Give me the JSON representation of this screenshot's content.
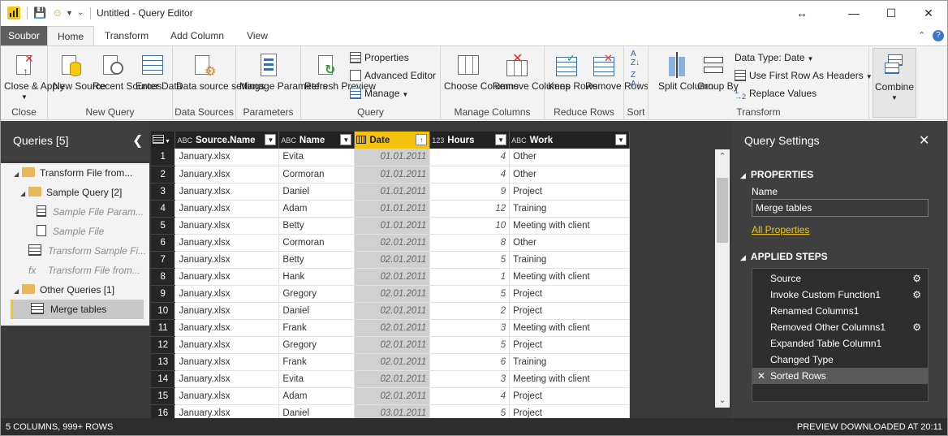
{
  "window": {
    "title": "Untitled - Query Editor",
    "minimize": "—",
    "maximize": "☐",
    "close": "✕",
    "resize": "↔"
  },
  "tabs": [
    {
      "label": "Soubor"
    },
    {
      "label": "Home"
    },
    {
      "label": "Transform"
    },
    {
      "label": "Add Column"
    },
    {
      "label": "View"
    }
  ],
  "ribbon": {
    "close_apply": "Close & Apply",
    "new_source": "New Source",
    "recent_sources": "Recent Sources",
    "enter_data": "Enter Data",
    "data_source_settings": "Data source settings",
    "manage_parameters": "Manage Parameters",
    "refresh_preview": "Refresh Preview",
    "properties": "Properties",
    "advanced_editor": "Advanced Editor",
    "manage": "Manage",
    "choose_columns": "Choose Columns",
    "remove_columns": "Remove Columns",
    "keep_rows": "Keep Rows",
    "remove_rows": "Remove Rows",
    "split_column": "Split Column",
    "group_by": "Group By",
    "data_type": "Data Type: Date",
    "use_first_row": "Use First Row As Headers",
    "replace_values": "Replace Values",
    "combine": "Combine",
    "groups": {
      "close": "Close",
      "new_query": "New Query",
      "data_sources": "Data Sources",
      "parameters": "Parameters",
      "query": "Query",
      "manage_columns": "Manage Columns",
      "reduce_rows": "Reduce Rows",
      "sort": "Sort",
      "transform": "Transform"
    }
  },
  "queries_pane": {
    "title": "Queries [5]",
    "items": [
      {
        "label": "Transform File from..."
      },
      {
        "label": "Sample Query [2]"
      },
      {
        "label": "Sample File Param..."
      },
      {
        "label": "Sample File"
      },
      {
        "label": "Transform Sample Fi..."
      },
      {
        "label": "Transform File from..."
      },
      {
        "label": "Other Queries [1]"
      },
      {
        "label": "Merge tables"
      }
    ]
  },
  "grid": {
    "columns": [
      {
        "type": "ABC",
        "name": "Source.Name"
      },
      {
        "type": "ABC",
        "name": "Name"
      },
      {
        "type": "",
        "name": "Date"
      },
      {
        "type": "123",
        "name": "Hours"
      },
      {
        "type": "ABC",
        "name": "Work"
      }
    ],
    "rows": [
      [
        "1",
        "January.xlsx",
        "Evita",
        "01.01.2011",
        "4",
        "Other"
      ],
      [
        "2",
        "January.xlsx",
        "Cormoran",
        "01.01.2011",
        "4",
        "Other"
      ],
      [
        "3",
        "January.xlsx",
        "Daniel",
        "01.01.2011",
        "9",
        "Project"
      ],
      [
        "4",
        "January.xlsx",
        "Adam",
        "01.01.2011",
        "12",
        "Training"
      ],
      [
        "5",
        "January.xlsx",
        "Betty",
        "01.01.2011",
        "10",
        "Meeting with client"
      ],
      [
        "6",
        "January.xlsx",
        "Cormoran",
        "02.01.2011",
        "8",
        "Other"
      ],
      [
        "7",
        "January.xlsx",
        "Betty",
        "02.01.2011",
        "5",
        "Training"
      ],
      [
        "8",
        "January.xlsx",
        "Hank",
        "02.01.2011",
        "1",
        "Meeting with client"
      ],
      [
        "9",
        "January.xlsx",
        "Gregory",
        "02.01.2011",
        "5",
        "Project"
      ],
      [
        "10",
        "January.xlsx",
        "Daniel",
        "02.01.2011",
        "2",
        "Project"
      ],
      [
        "11",
        "January.xlsx",
        "Frank",
        "02.01.2011",
        "3",
        "Meeting with client"
      ],
      [
        "12",
        "January.xlsx",
        "Gregory",
        "02.01.2011",
        "5",
        "Project"
      ],
      [
        "13",
        "January.xlsx",
        "Frank",
        "02.01.2011",
        "6",
        "Training"
      ],
      [
        "14",
        "January.xlsx",
        "Evita",
        "02.01.2011",
        "3",
        "Meeting with client"
      ],
      [
        "15",
        "January.xlsx",
        "Adam",
        "02.01.2011",
        "4",
        "Project"
      ],
      [
        "16",
        "January.xlsx",
        "Daniel",
        "03.01.2011",
        "5",
        "Project"
      ]
    ]
  },
  "settings_pane": {
    "title": "Query Settings",
    "properties_header": "PROPERTIES",
    "name_label": "Name",
    "name_value": "Merge tables",
    "all_properties": "All Properties",
    "applied_steps_header": "APPLIED STEPS",
    "steps": [
      {
        "label": "Source"
      },
      {
        "label": "Invoke Custom Function1"
      },
      {
        "label": "Renamed Columns1"
      },
      {
        "label": "Removed Other Columns1"
      },
      {
        "label": "Expanded Table Column1"
      },
      {
        "label": "Changed Type"
      },
      {
        "label": "Sorted Rows"
      }
    ]
  },
  "status": {
    "left": "5 COLUMNS, 999+ ROWS",
    "right": "PREVIEW DOWNLOADED AT 20:11"
  },
  "colors": {
    "accent": "#f2c811",
    "dark_pane": "#3a3a3a",
    "sorted_column": "#f4c20d"
  }
}
